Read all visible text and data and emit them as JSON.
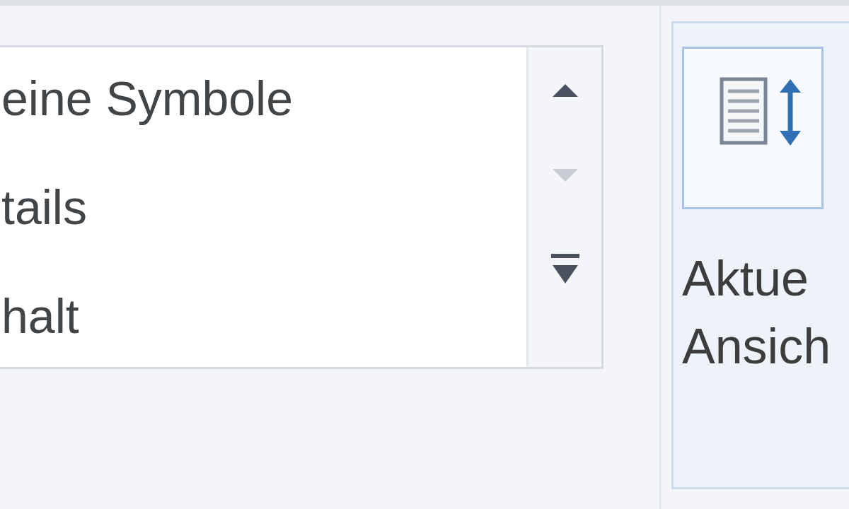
{
  "view_list": {
    "items": [
      {
        "label": "eine Symbole"
      },
      {
        "label": "tails"
      },
      {
        "label": "halt"
      }
    ],
    "scroll_buttons": [
      {
        "kind": "up",
        "disabled": false
      },
      {
        "kind": "down",
        "disabled": true
      },
      {
        "kind": "more",
        "disabled": false
      }
    ]
  },
  "size_button": {
    "label_lines": [
      "Aktue",
      "Ansich"
    ]
  }
}
